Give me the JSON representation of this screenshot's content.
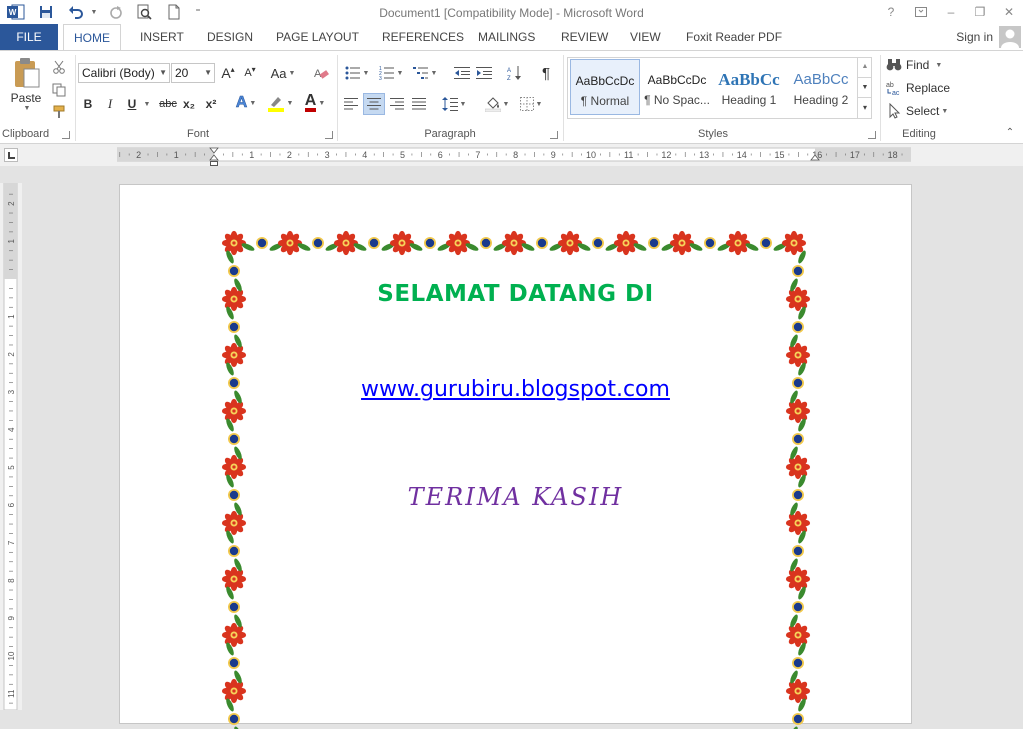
{
  "window": {
    "title": "Document1 [Compatibility Mode] - Microsoft Word",
    "controls": [
      "?",
      "□",
      "–",
      "❐",
      "✕"
    ]
  },
  "qat": {
    "icons": [
      "word-logo-icon",
      "save-icon",
      "undo-icon",
      "redo-icon",
      "print-preview-icon",
      "new-document-icon",
      "customize-icon"
    ]
  },
  "tabs": {
    "file": "FILE",
    "home": "HOME",
    "insert": "INSERT",
    "design": "DESIGN",
    "page_layout": "PAGE LAYOUT",
    "references": "REFERENCES",
    "mailings": "MAILINGS",
    "review": "REVIEW",
    "view": "VIEW",
    "foxit": "Foxit Reader PDF",
    "signin": "Sign in"
  },
  "ribbon": {
    "clipboard": {
      "label": "Clipboard",
      "paste": "Paste"
    },
    "font": {
      "label": "Font",
      "family": "Calibri (Body)",
      "size": "20",
      "grow": "A",
      "shrink": "A",
      "case": "Aa",
      "bold": "B",
      "italic": "I",
      "underline": "U",
      "strike": "abc",
      "subscript": "x₂",
      "superscript": "x²",
      "effects": "A",
      "font_color": "A"
    },
    "paragraph": {
      "label": "Paragraph",
      "pilcrow": "¶"
    },
    "styles": {
      "label": "Styles",
      "items": [
        {
          "sample": "AaBbCcDc",
          "name": "¶ Normal"
        },
        {
          "sample": "AaBbCcDc",
          "name": "¶ No Spac..."
        },
        {
          "sample": "AaBbCc",
          "name": "Heading 1"
        },
        {
          "sample": "AaBbCc",
          "name": "Heading 2"
        }
      ]
    },
    "editing": {
      "label": "Editing",
      "find": "Find",
      "replace": "Replace",
      "select": "Select"
    }
  },
  "ruler": {
    "h_ticks": [
      "2",
      "1",
      "1",
      "2",
      "3",
      "4",
      "5",
      "6",
      "7",
      "8",
      "9",
      "10",
      "11",
      "12",
      "13",
      "14",
      "15",
      "16",
      "17",
      "18"
    ],
    "v_ticks": [
      "2",
      "1",
      "1",
      "2",
      "3",
      "4",
      "5",
      "6",
      "7",
      "8",
      "9",
      "10",
      "11"
    ]
  },
  "document": {
    "heading": "SELAMAT DATANG DI",
    "link": "www.gurubiru.blogspot.com",
    "thanks": "TERIMA KASIH"
  },
  "colors": {
    "file_tab": "#2b579a",
    "heading": "#00b050",
    "link": "#0000ff",
    "thanks": "#7030a0",
    "border_flower": "#d9341e",
    "border_leaf": "#3a8a2e",
    "border_dot": "#1a3a8c"
  }
}
